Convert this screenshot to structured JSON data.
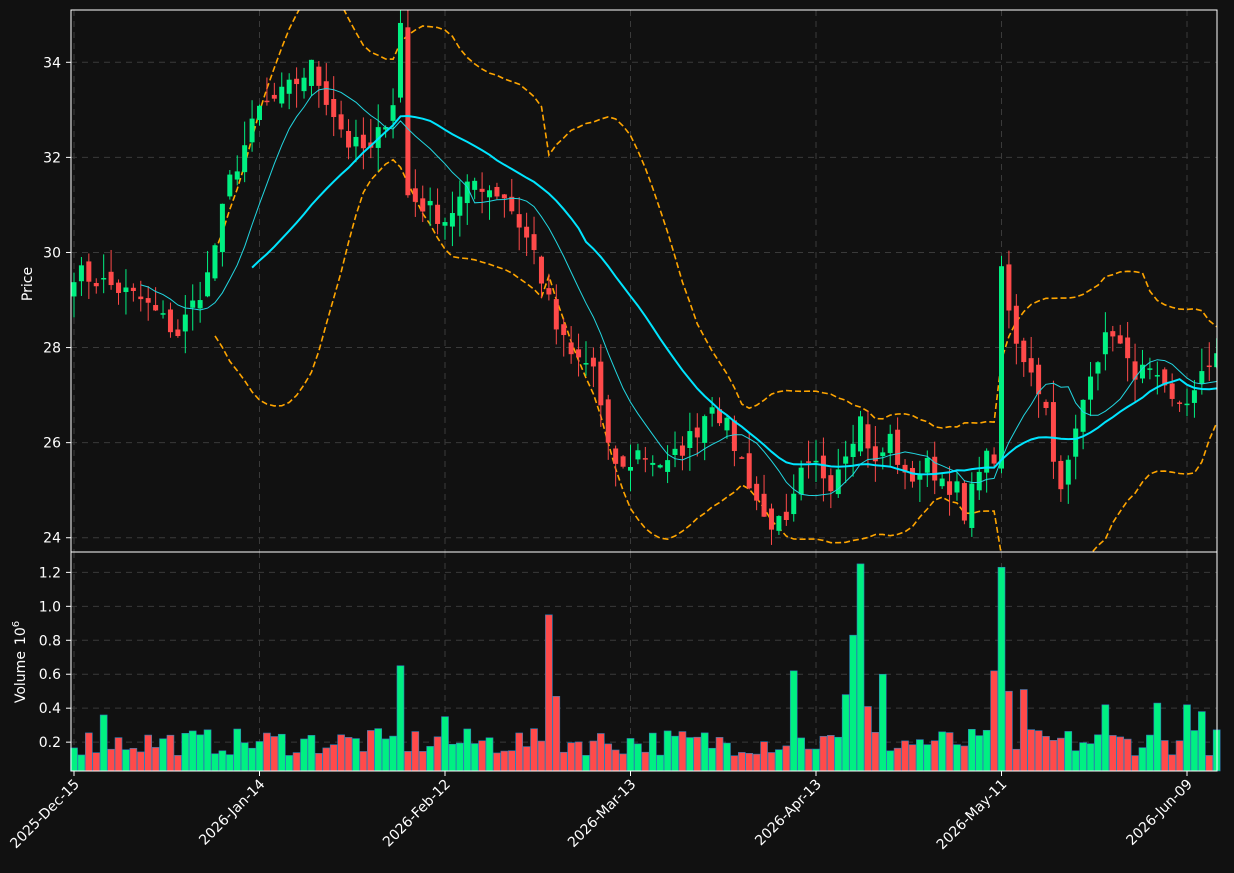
{
  "colors": {
    "background": "#111111",
    "up": "#00f082",
    "down": "#ff4a4a",
    "ma_fast": "#22d6e0",
    "ma_slow": "#00e5ff",
    "bands": "#ffa500",
    "grid": "#3a3a3a",
    "text": "#ffffff"
  },
  "chart_data": {
    "type": "candlestick",
    "price_axis": {
      "label": "Price",
      "ticks": [
        "24",
        "26",
        "28",
        "30",
        "32",
        "34"
      ],
      "ylim": [
        23.7,
        35.1
      ]
    },
    "volume_axis": {
      "label": "Volume",
      "exponent": "10",
      "exponent_power": "6",
      "ticks": [
        "0.2",
        "0.4",
        "0.6",
        "0.8",
        "1.0",
        "1.2"
      ],
      "ylim": [
        0.03,
        1.32
      ]
    },
    "x_axis": {
      "tick_labels": [
        "2025-Dec-15",
        "2026-Jan-14",
        "2026-Feb-12",
        "2026-Mar-13",
        "2026-Apr-13",
        "2026-May-11",
        "2026-Jun-09"
      ],
      "tick_indices": [
        0,
        25,
        50,
        75,
        100,
        125,
        150
      ]
    },
    "grid": true,
    "series": [
      {
        "role": "candles",
        "columns": [
          "open",
          "high",
          "low",
          "close"
        ]
      },
      {
        "role": "volume_bars"
      },
      {
        "role": "moving_average_fast"
      },
      {
        "role": "moving_average_slow"
      },
      {
        "role": "bollinger_bands"
      }
    ],
    "anchors": [
      [
        0,
        29.6
      ],
      [
        5,
        29.3
      ],
      [
        9,
        29.0
      ],
      [
        14,
        28.3
      ],
      [
        18,
        29.5
      ],
      [
        21,
        31.5
      ],
      [
        25,
        33.0
      ],
      [
        28,
        33.3
      ],
      [
        32,
        33.9
      ],
      [
        37,
        32.3
      ],
      [
        40,
        32.1
      ],
      [
        43,
        33.2
      ],
      [
        44,
        34.8
      ],
      [
        45,
        31.2
      ],
      [
        50,
        30.7
      ],
      [
        54,
        31.5
      ],
      [
        58,
        31.2
      ],
      [
        62,
        30.0
      ],
      [
        65,
        28.4
      ],
      [
        67,
        27.8
      ],
      [
        70,
        27.6
      ],
      [
        72,
        25.8
      ],
      [
        74,
        25.4
      ],
      [
        76,
        25.8
      ],
      [
        80,
        25.5
      ],
      [
        84,
        26.3
      ],
      [
        86,
        26.9
      ],
      [
        88,
        26.3
      ],
      [
        90,
        25.6
      ],
      [
        93,
        24.4
      ],
      [
        96,
        24.2
      ],
      [
        98,
        25.3
      ],
      [
        100,
        25.5
      ],
      [
        102,
        25.2
      ],
      [
        104,
        25.9
      ],
      [
        106,
        26.5
      ],
      [
        108,
        25.5
      ],
      [
        110,
        26.1
      ],
      [
        112,
        25.2
      ],
      [
        115,
        25.5
      ],
      [
        119,
        25.0
      ],
      [
        120,
        24.3
      ],
      [
        122,
        25.6
      ],
      [
        124,
        25.7
      ],
      [
        125,
        29.5
      ],
      [
        127,
        28.0
      ],
      [
        129,
        27.6
      ],
      [
        131,
        26.7
      ],
      [
        133,
        24.9
      ],
      [
        135,
        26.2
      ],
      [
        137,
        27.6
      ],
      [
        140,
        28.4
      ],
      [
        142,
        27.6
      ],
      [
        145,
        27.4
      ],
      [
        148,
        26.8
      ],
      [
        151,
        27.0
      ],
      [
        154,
        28.0
      ]
    ],
    "volume_spikes": [
      [
        4,
        0.36
      ],
      [
        44,
        0.65
      ],
      [
        50,
        0.35
      ],
      [
        64,
        0.95
      ],
      [
        65,
        0.47
      ],
      [
        97,
        0.62
      ],
      [
        104,
        0.48
      ],
      [
        105,
        0.83
      ],
      [
        106,
        1.25
      ],
      [
        107,
        0.41
      ],
      [
        109,
        0.6
      ],
      [
        124,
        0.62
      ],
      [
        125,
        1.23
      ],
      [
        126,
        0.5
      ],
      [
        128,
        0.51
      ],
      [
        139,
        0.42
      ],
      [
        146,
        0.43
      ],
      [
        150,
        0.42
      ],
      [
        152,
        0.38
      ]
    ]
  }
}
